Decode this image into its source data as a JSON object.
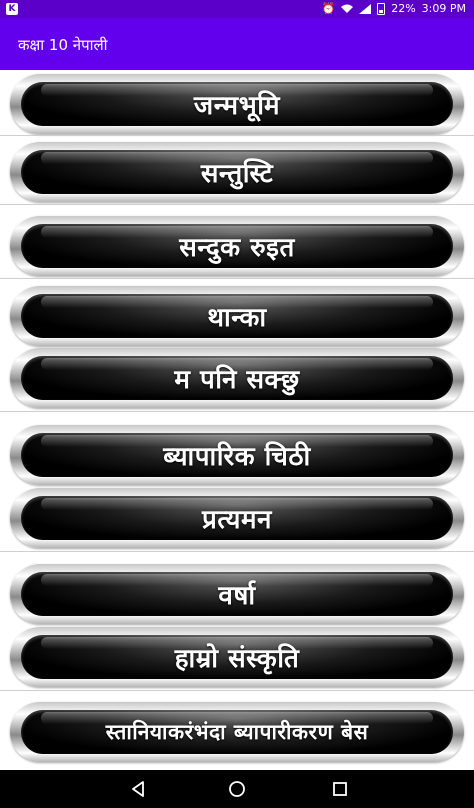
{
  "status_bar": {
    "left_icon": "K",
    "battery_percent": "22%",
    "time": "3:09 PM",
    "icons": [
      "alarm-icon",
      "wifi-icon",
      "signal-icon",
      "battery-icon"
    ]
  },
  "app_bar": {
    "title": "कक्षा 10 नेपाली"
  },
  "list": {
    "items": [
      {
        "label": "जन्मभूमि"
      },
      {
        "label": "सन्तुस्टि"
      },
      {
        "label": "सन्दुक रुइत"
      },
      {
        "label": "थान्का"
      },
      {
        "label": "म पनि सक्छु"
      },
      {
        "label": "ब्यापारिक चिठी"
      },
      {
        "label": "प्रत्यमन"
      },
      {
        "label": "वर्षा"
      },
      {
        "label": "हाम्रो संस्कृति"
      },
      {
        "label": "स्तानियाकरंभंदा ब्यापारीकरण बेस"
      }
    ]
  },
  "nav_bar": {
    "buttons": [
      "back-icon",
      "home-icon",
      "recent-apps-icon"
    ]
  },
  "colors": {
    "status_bar": "#5a00c8",
    "app_bar": "#6200ee",
    "button_face": "#000000"
  }
}
